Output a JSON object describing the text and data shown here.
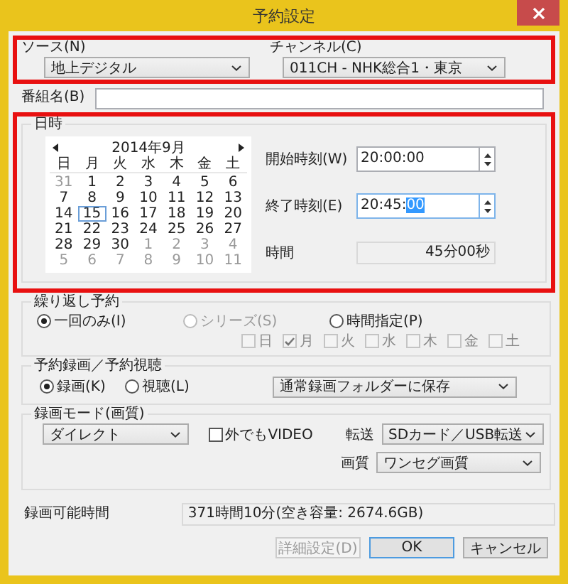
{
  "window": {
    "title": "予約設定"
  },
  "top": {
    "highlighted": true,
    "source": {
      "label": "ソース(N)",
      "value": "地上デジタル"
    },
    "channel": {
      "label": "チャンネル(C)",
      "value": "011CH - NHK総合1・東京"
    }
  },
  "program_name": {
    "label": "番組名(B)"
  },
  "datetime": {
    "title": "日時",
    "highlighted": true,
    "calendar": {
      "month": "2014年9月",
      "weekdays": [
        "日",
        "月",
        "火",
        "水",
        "木",
        "金",
        "土"
      ],
      "days": [
        {
          "day": "31",
          "other_month": true,
          "selected": false
        },
        {
          "day": "1",
          "other_month": false,
          "selected": false
        },
        {
          "day": "2",
          "other_month": false,
          "selected": false
        },
        {
          "day": "3",
          "other_month": false,
          "selected": false
        },
        {
          "day": "4",
          "other_month": false,
          "selected": false
        },
        {
          "day": "5",
          "other_month": false,
          "selected": false
        },
        {
          "day": "6",
          "other_month": false,
          "selected": false
        },
        {
          "day": "7",
          "other_month": false,
          "selected": false
        },
        {
          "day": "8",
          "other_month": false,
          "selected": false
        },
        {
          "day": "9",
          "other_month": false,
          "selected": false
        },
        {
          "day": "10",
          "other_month": false,
          "selected": false
        },
        {
          "day": "11",
          "other_month": false,
          "selected": false
        },
        {
          "day": "12",
          "other_month": false,
          "selected": false
        },
        {
          "day": "13",
          "other_month": false,
          "selected": false
        },
        {
          "day": "14",
          "other_month": false,
          "selected": false
        },
        {
          "day": "15",
          "other_month": false,
          "selected": true
        },
        {
          "day": "16",
          "other_month": false,
          "selected": false
        },
        {
          "day": "17",
          "other_month": false,
          "selected": false
        },
        {
          "day": "18",
          "other_month": false,
          "selected": false
        },
        {
          "day": "19",
          "other_month": false,
          "selected": false
        },
        {
          "day": "20",
          "other_month": false,
          "selected": false
        },
        {
          "day": "21",
          "other_month": false,
          "selected": false
        },
        {
          "day": "22",
          "other_month": false,
          "selected": false
        },
        {
          "day": "23",
          "other_month": false,
          "selected": false
        },
        {
          "day": "24",
          "other_month": false,
          "selected": false
        },
        {
          "day": "25",
          "other_month": false,
          "selected": false
        },
        {
          "day": "26",
          "other_month": false,
          "selected": false
        },
        {
          "day": "27",
          "other_month": false,
          "selected": false
        },
        {
          "day": "28",
          "other_month": false,
          "selected": false
        },
        {
          "day": "29",
          "other_month": false,
          "selected": false
        },
        {
          "day": "30",
          "other_month": false,
          "selected": false
        },
        {
          "day": "1",
          "other_month": true,
          "selected": false
        },
        {
          "day": "2",
          "other_month": true,
          "selected": false
        },
        {
          "day": "3",
          "other_month": true,
          "selected": false
        },
        {
          "day": "4",
          "other_month": true,
          "selected": false
        },
        {
          "day": "5",
          "other_month": true,
          "selected": false
        },
        {
          "day": "6",
          "other_month": true,
          "selected": false
        },
        {
          "day": "7",
          "other_month": true,
          "selected": false
        },
        {
          "day": "8",
          "other_month": true,
          "selected": false
        },
        {
          "day": "9",
          "other_month": true,
          "selected": false
        },
        {
          "day": "10",
          "other_month": true,
          "selected": false
        },
        {
          "day": "11",
          "other_month": true,
          "selected": false
        }
      ]
    },
    "start": {
      "label": "開始時刻(W)",
      "value": "20:00:00"
    },
    "end": {
      "label": "終了時刻(E)",
      "value": "20:45:",
      "selection": "00"
    },
    "duration": {
      "label": "時間",
      "value": "45分00秒"
    }
  },
  "repeat": {
    "title": "繰り返し予約",
    "options": [
      {
        "label": "一回のみ(I)",
        "selected": true,
        "disabled": false
      },
      {
        "label": "シリーズ(S)",
        "selected": false,
        "disabled": true
      },
      {
        "label": "時間指定(P)",
        "selected": false,
        "disabled": false
      }
    ],
    "days_disabled": true,
    "days": [
      {
        "label": "日",
        "checked": false
      },
      {
        "label": "月",
        "checked": true
      },
      {
        "label": "火",
        "checked": false
      },
      {
        "label": "水",
        "checked": false
      },
      {
        "label": "木",
        "checked": false
      },
      {
        "label": "金",
        "checked": false
      },
      {
        "label": "土",
        "checked": false
      }
    ]
  },
  "record": {
    "title": "予約録画／予約視聴",
    "options": [
      {
        "label": "録画(K)",
        "selected": true
      },
      {
        "label": "視聴(L)",
        "selected": false
      }
    ],
    "folder": "通常録画フォルダーに保存"
  },
  "mode": {
    "title": "録画モード(画質)",
    "value": "ダイレクト",
    "video_out": {
      "label": "外でもVIDEO",
      "checked": false
    },
    "transfer": {
      "label": "転送",
      "value": "SDカード／USB転送"
    },
    "quality": {
      "label": "画質",
      "value": "ワンセグ画質"
    }
  },
  "available": {
    "label": "録画可能時間",
    "value": "371時間10分(空き容量: 2674.6GB)"
  },
  "buttons": [
    {
      "label": "詳細設定(D)",
      "disabled": true,
      "default": false
    },
    {
      "label": "OK",
      "disabled": false,
      "default": true
    },
    {
      "label": "キャンセル",
      "disabled": false,
      "default": false
    }
  ]
}
